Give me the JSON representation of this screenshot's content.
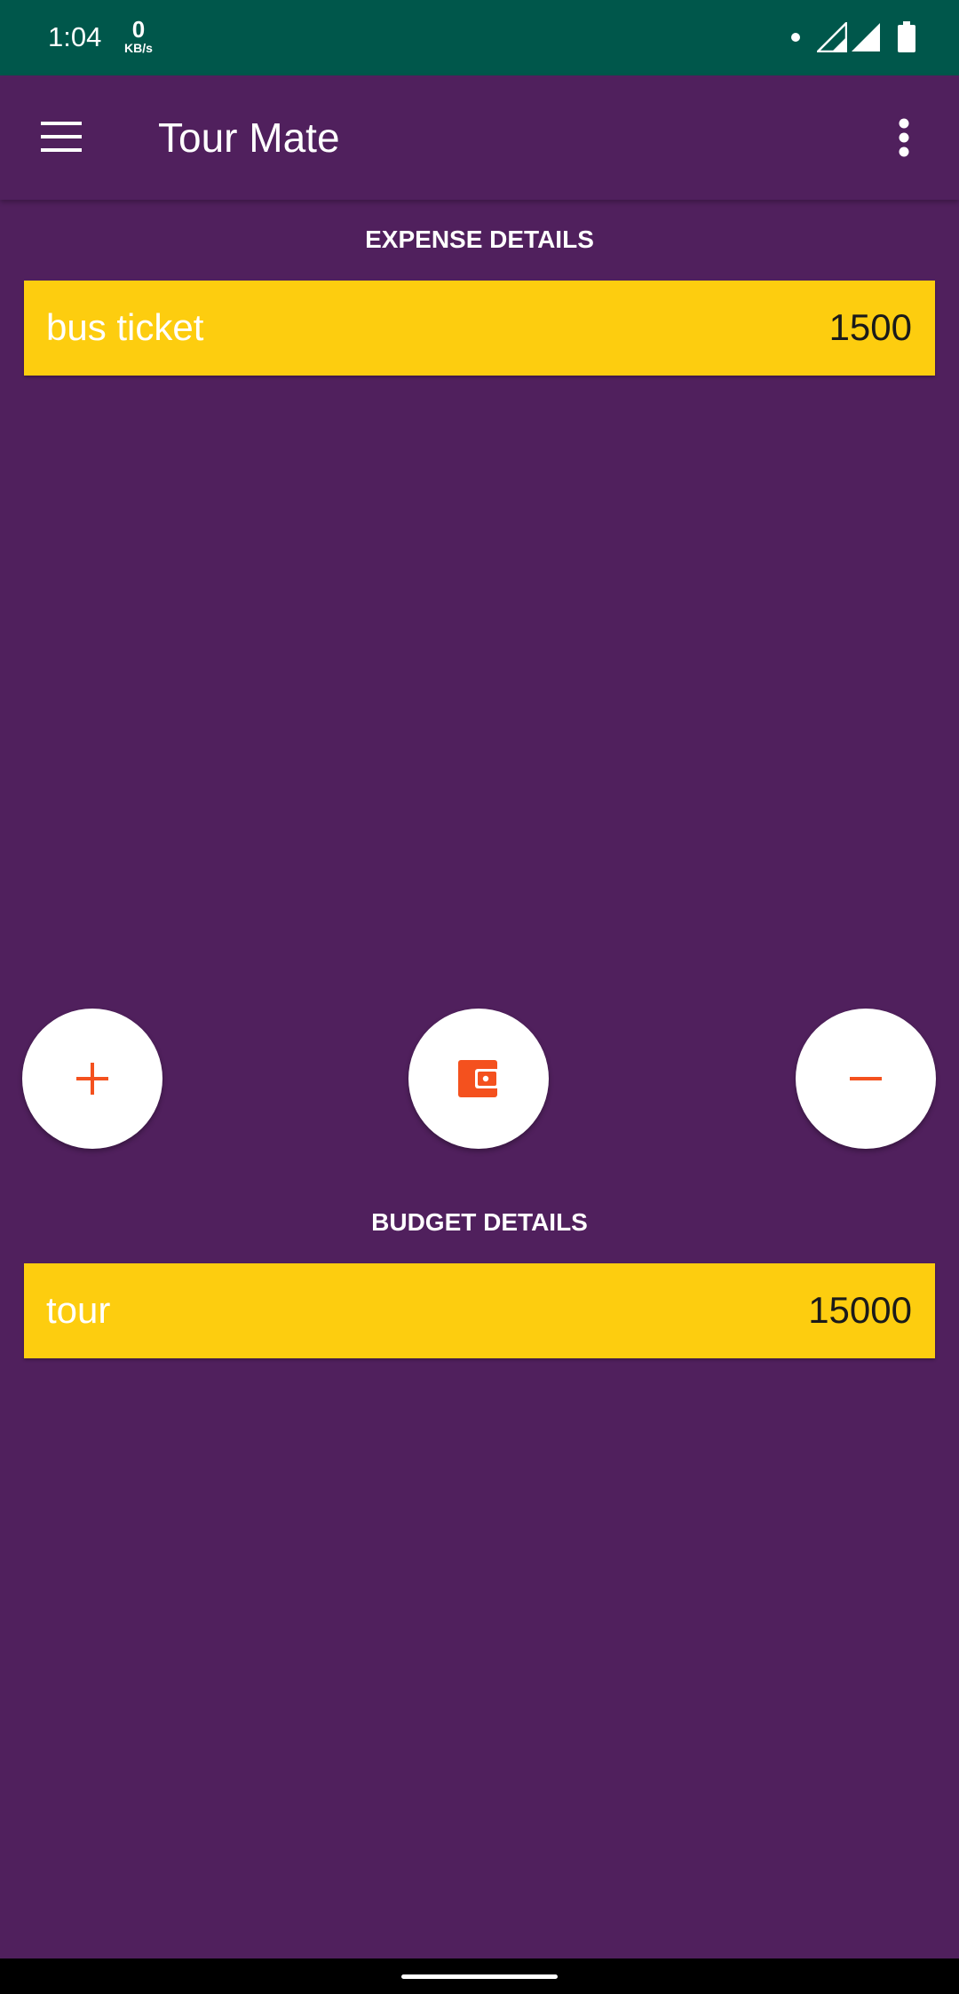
{
  "status_bar": {
    "time": "1:04",
    "net_speed_value": "0",
    "net_speed_unit": "KB/s",
    "icons": [
      "notification-dot-icon",
      "signal-icon",
      "signal-icon",
      "battery-icon"
    ]
  },
  "app_bar": {
    "title": "Tour Mate",
    "menu_icon": "hamburger-menu-icon",
    "overflow_icon": "more-vert-icon"
  },
  "expense": {
    "heading": "EXPENSE DETAILS",
    "items": [
      {
        "name": "bus ticket",
        "amount": "1500"
      }
    ]
  },
  "actions": {
    "add_icon": "plus-icon",
    "wallet_icon": "wallet-icon",
    "remove_icon": "minus-icon",
    "icon_color": "#f4511e"
  },
  "budget": {
    "heading": "BUDGET DETAILS",
    "items": [
      {
        "name": "tour",
        "amount": "15000"
      }
    ]
  },
  "colors": {
    "background": "#50205d",
    "status_bar": "#00574b",
    "row_card": "#fdcd0f",
    "accent": "#f4511e"
  }
}
